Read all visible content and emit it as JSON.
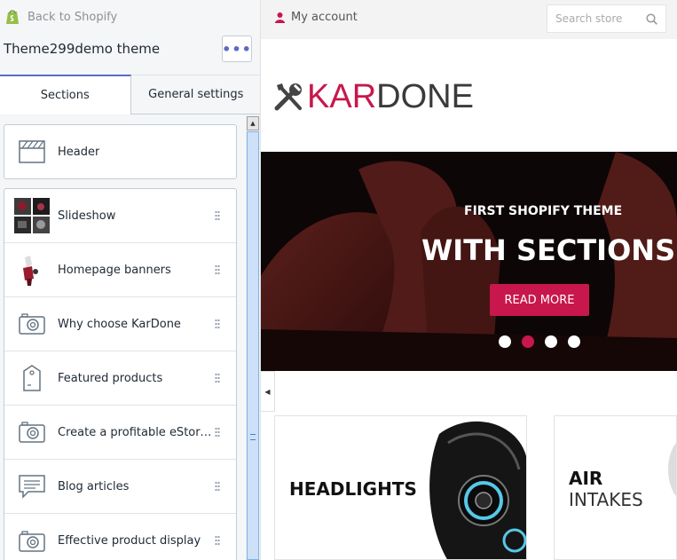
{
  "editor": {
    "back_label": "Back to Shopify",
    "theme_title": "Theme299demo theme",
    "more_label": "•••",
    "tabs": [
      {
        "label": "Sections",
        "active": true
      },
      {
        "label": "General settings",
        "active": false
      }
    ],
    "header_section": {
      "label": "Header",
      "icon": "header-icon"
    },
    "sections": [
      {
        "label": "Slideshow",
        "icon": "slideshow-thumbnail"
      },
      {
        "label": "Homepage banners",
        "icon": "banners-thumbnail"
      },
      {
        "label": "Why choose KarDone",
        "icon": "camera-icon"
      },
      {
        "label": "Featured products",
        "icon": "tag-icon"
      },
      {
        "label": "Create a profitable eStore ...",
        "icon": "camera-icon"
      },
      {
        "label": "Blog articles",
        "icon": "comment-icon"
      },
      {
        "label": "Effective product display",
        "icon": "camera-icon"
      }
    ],
    "accent_color": "#5c6ac4"
  },
  "preview": {
    "account_label": "My account",
    "search_placeholder": "Search store",
    "logo": {
      "part1": "KAR",
      "part2": "DONE",
      "part1_color": "#c8174d",
      "part2_color": "#3a3a3a"
    },
    "hero": {
      "subtitle": "FIRST SHOPIFY THEME",
      "title": "WITH SECTIONS",
      "button_label": "READ MORE",
      "slide_count": 4,
      "active_slide": 2
    },
    "banners": [
      {
        "title": "HEADLIGHTS"
      },
      {
        "title_bold": "AIR",
        "title_light": "INTAKES"
      }
    ],
    "brand_color": "#c8174d"
  }
}
